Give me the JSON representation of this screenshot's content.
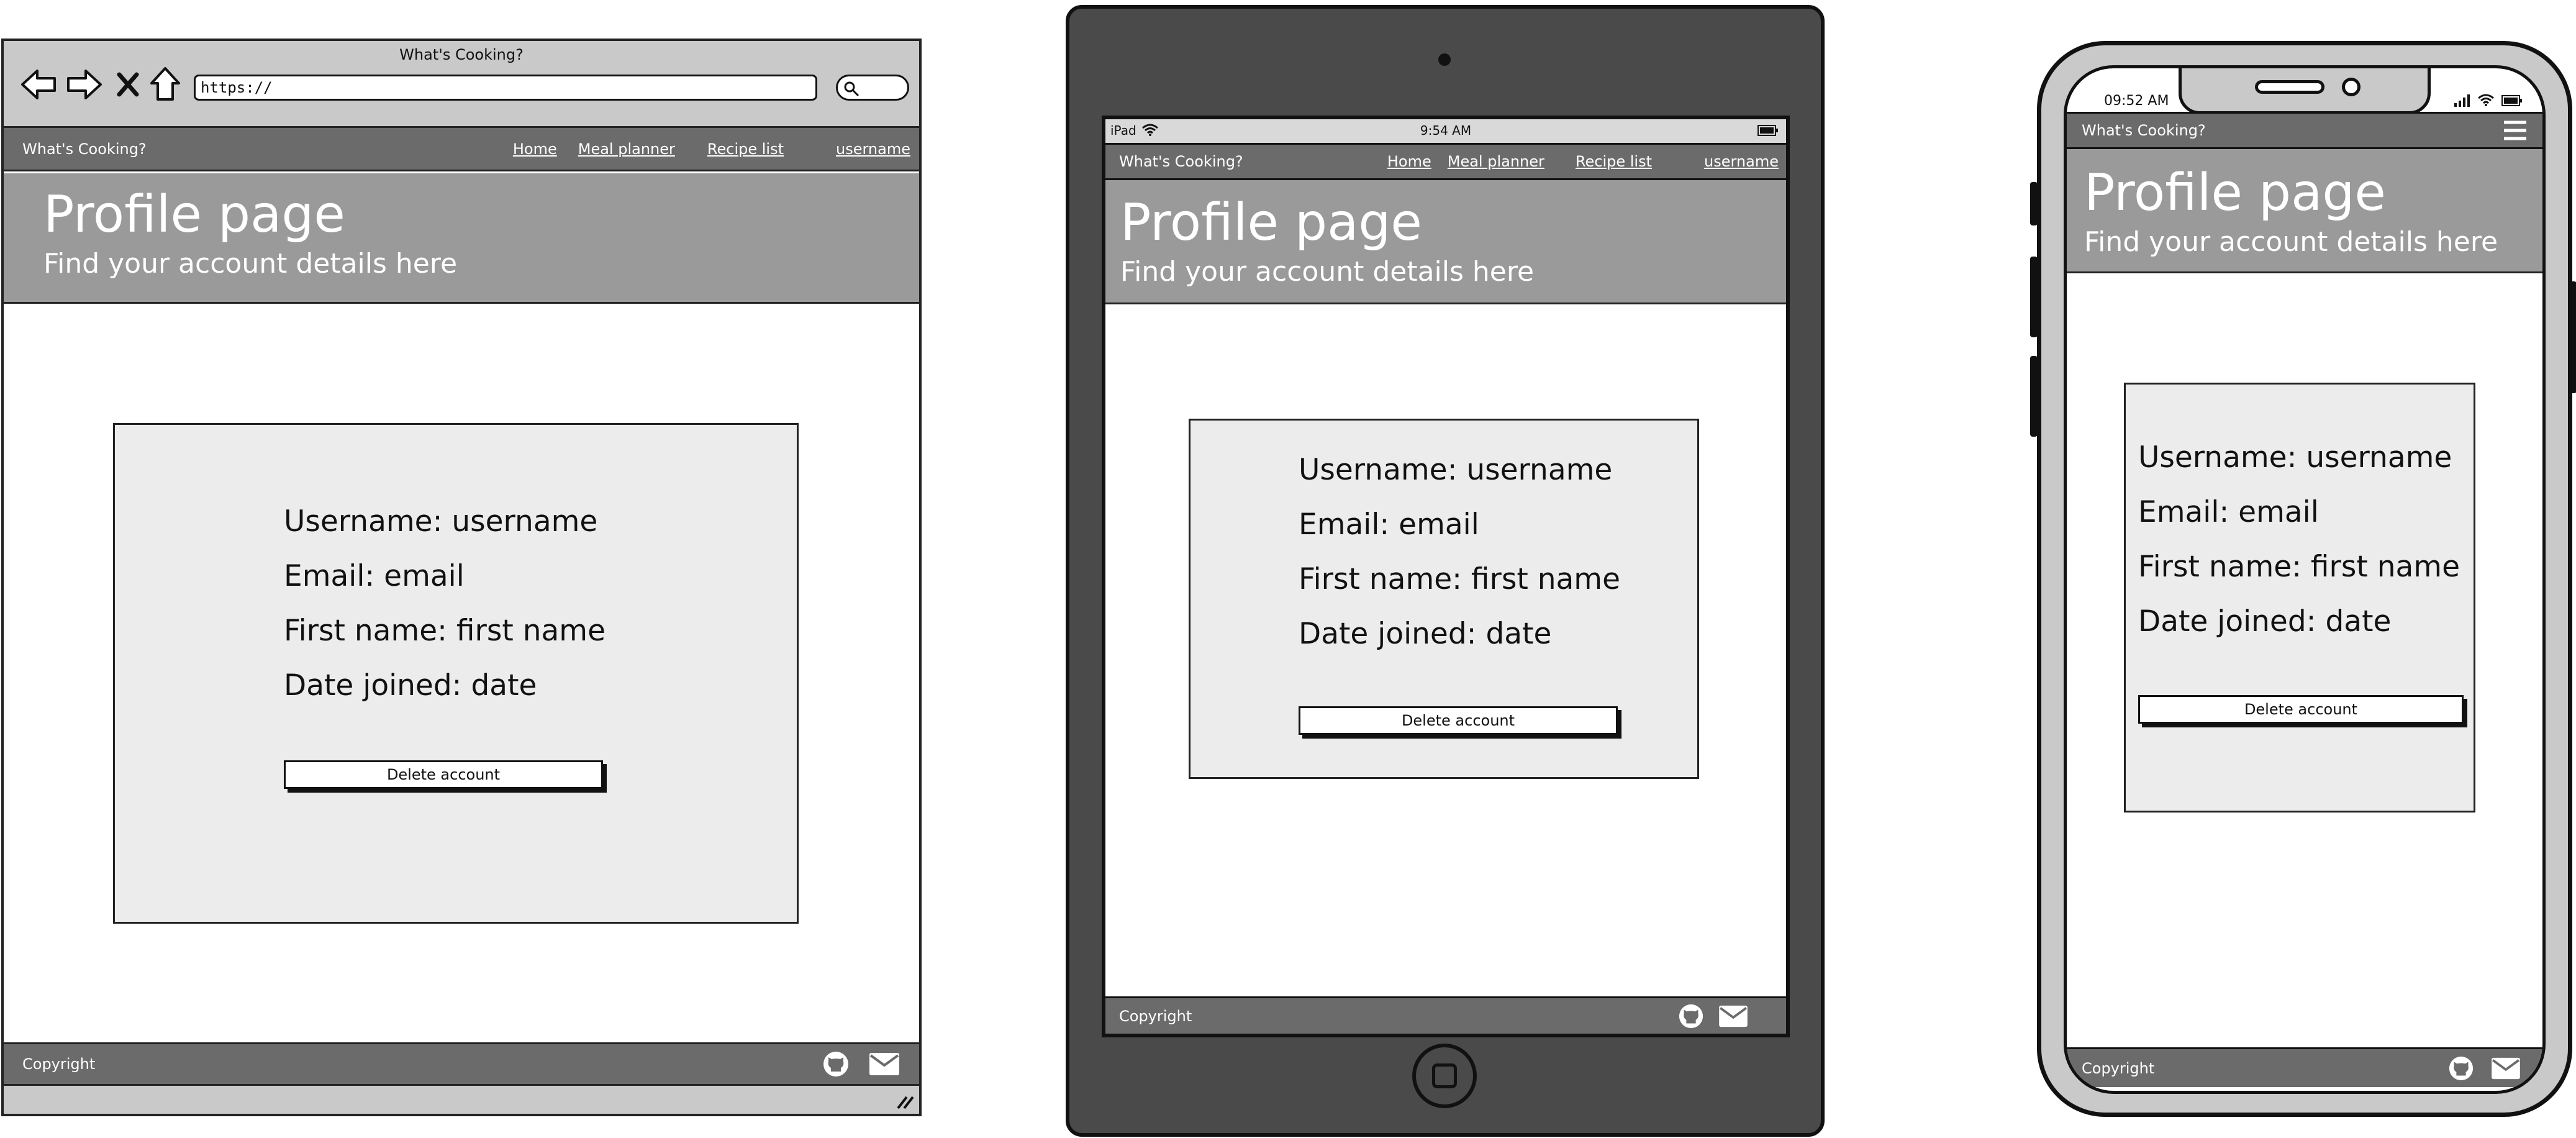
{
  "browser": {
    "window_title": "What's Cooking?",
    "url": "https://",
    "nav_brand": "What's Cooking?",
    "links": [
      "Home",
      "Meal planner",
      "Recipe list",
      "username"
    ],
    "hero_title": "Profile page",
    "hero_subtitle": "Find your account details here",
    "profile": {
      "username": "Username: username",
      "email": "Email: email",
      "first_name": "First name: first name",
      "date_joined": "Date joined: date",
      "delete_label": "Delete account"
    },
    "footer": "Copyright"
  },
  "tablet": {
    "status_device": "iPad",
    "status_time": "9:54 AM",
    "nav_brand": "What's Cooking?",
    "links": [
      "Home",
      "Meal planner",
      "Recipe list",
      "username"
    ],
    "hero_title": "Profile page",
    "hero_subtitle": "Find your account details here",
    "profile": {
      "username": "Username: username",
      "email": "Email: email",
      "first_name": "First name: first name",
      "date_joined": "Date joined: date",
      "delete_label": "Delete account"
    },
    "footer": "Copyright"
  },
  "phone": {
    "status_time": "09:52 AM",
    "nav_brand": "What's Cooking?",
    "hero_title": "Profile page",
    "hero_subtitle": "Find your account details here",
    "profile": {
      "username": "Username: username",
      "email": "Email: email",
      "first_name": "First name: first name",
      "date_joined": "Date joined: date",
      "delete_label": "Delete account"
    },
    "footer": "Copyright"
  },
  "icons": [
    "back-arrow-icon",
    "forward-arrow-icon",
    "close-icon",
    "home-icon",
    "search-icon",
    "github-icon",
    "mail-icon",
    "hamburger-menu-icon",
    "wifi-icon",
    "battery-icon",
    "signal-icon",
    "camera-icon",
    "home-button-icon",
    "resize-grip-icon"
  ],
  "colors": {
    "navbar": "#6b6b6b",
    "hero": "#9a9a9a",
    "card": "#ececec",
    "device_body": "#4a4a4a"
  }
}
